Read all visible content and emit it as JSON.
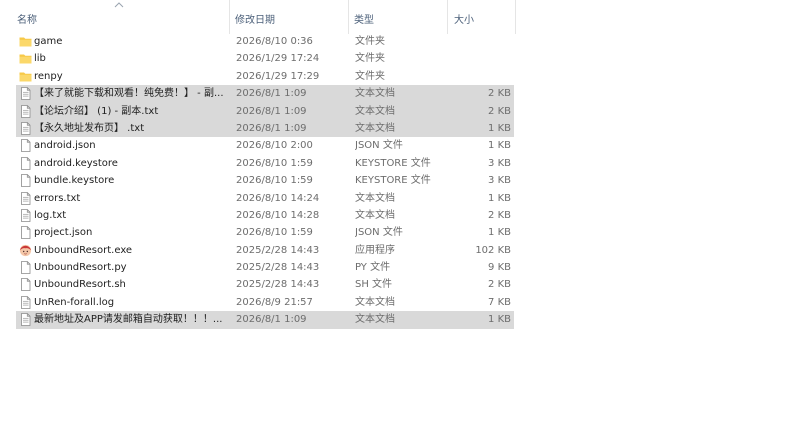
{
  "columns": {
    "name": "名称",
    "date": "修改日期",
    "type": "类型",
    "size": "大小"
  },
  "files": [
    {
      "icon": "folder-icon",
      "name": "game",
      "date": "2026/8/10 0:36",
      "type": "文件夹",
      "size": "",
      "selected": false
    },
    {
      "icon": "folder-icon",
      "name": "lib",
      "date": "2026/1/29 17:24",
      "type": "文件夹",
      "size": "",
      "selected": false
    },
    {
      "icon": "folder-icon",
      "name": "renpy",
      "date": "2026/1/29 17:29",
      "type": "文件夹",
      "size": "",
      "selected": false
    },
    {
      "icon": "text-file-icon",
      "name": "【来了就能下载和观看！纯免费！】 - 副...",
      "date": "2026/8/1 1:09",
      "type": "文本文档",
      "size": "2 KB",
      "selected": true
    },
    {
      "icon": "text-file-icon",
      "name": "【论坛介绍】 (1) - 副本.txt",
      "date": "2026/8/1 1:09",
      "type": "文本文档",
      "size": "2 KB",
      "selected": true
    },
    {
      "icon": "text-file-icon",
      "name": "【永久地址发布页】 .txt",
      "date": "2026/8/1 1:09",
      "type": "文本文档",
      "size": "1 KB",
      "selected": true
    },
    {
      "icon": "file-icon",
      "name": "android.json",
      "date": "2026/8/10 2:00",
      "type": "JSON 文件",
      "size": "1 KB",
      "selected": false
    },
    {
      "icon": "file-icon",
      "name": "android.keystore",
      "date": "2026/8/10 1:59",
      "type": "KEYSTORE 文件",
      "size": "3 KB",
      "selected": false
    },
    {
      "icon": "file-icon",
      "name": "bundle.keystore",
      "date": "2026/8/10 1:59",
      "type": "KEYSTORE 文件",
      "size": "3 KB",
      "selected": false
    },
    {
      "icon": "text-file-icon",
      "name": "errors.txt",
      "date": "2026/8/10 14:24",
      "type": "文本文档",
      "size": "1 KB",
      "selected": false
    },
    {
      "icon": "text-file-icon",
      "name": "log.txt",
      "date": "2026/8/10 14:28",
      "type": "文本文档",
      "size": "2 KB",
      "selected": false
    },
    {
      "icon": "file-icon",
      "name": "project.json",
      "date": "2026/8/10 1:59",
      "type": "JSON 文件",
      "size": "1 KB",
      "selected": false
    },
    {
      "icon": "app-icon",
      "name": "UnboundResort.exe",
      "date": "2025/2/28 14:43",
      "type": "应用程序",
      "size": "102 KB",
      "selected": false
    },
    {
      "icon": "file-icon",
      "name": "UnboundResort.py",
      "date": "2025/2/28 14:43",
      "type": "PY 文件",
      "size": "9 KB",
      "selected": false
    },
    {
      "icon": "file-icon",
      "name": "UnboundResort.sh",
      "date": "2025/2/28 14:43",
      "type": "SH 文件",
      "size": "2 KB",
      "selected": false
    },
    {
      "icon": "text-file-icon",
      "name": "UnRen-forall.log",
      "date": "2026/8/9 21:57",
      "type": "文本文档",
      "size": "7 KB",
      "selected": false
    },
    {
      "icon": "text-file-icon",
      "name": "最新地址及APP请发邮箱自动获取！！！...",
      "date": "2026/8/1 1:09",
      "type": "文本文档",
      "size": "1 KB",
      "selected": true
    }
  ]
}
